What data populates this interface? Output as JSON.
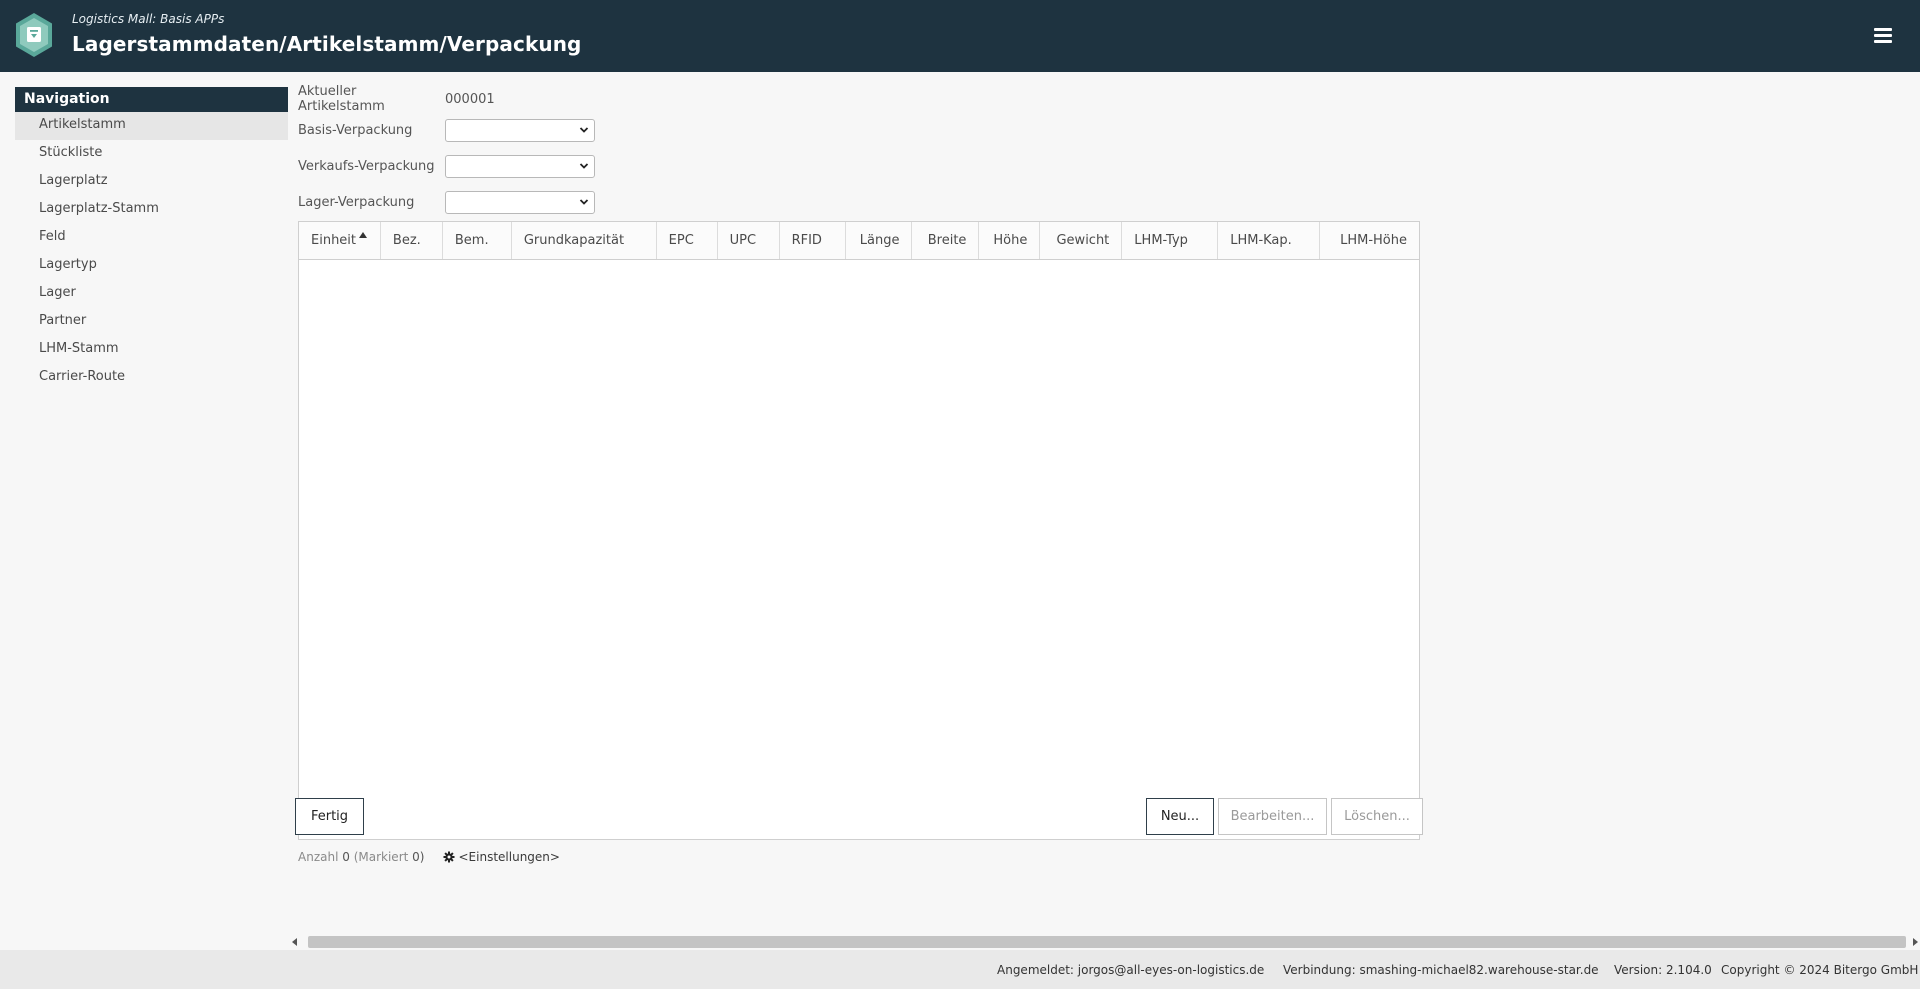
{
  "header": {
    "subtitle": "Logistics Mall: Basis APPs",
    "title": "Lagerstammdaten/Artikelstamm/Verpackung",
    "menu_icon": "hamburger-menu-icon",
    "logo_icon": "hexagon-logo-icon"
  },
  "colors": {
    "header_bg": "#1e3340",
    "accent": "#1e3340",
    "logo_teal": "#5aa89a"
  },
  "navigation": {
    "title": "Navigation",
    "items": [
      {
        "label": "Artikelstamm",
        "active": true
      },
      {
        "label": "Stückliste"
      },
      {
        "label": "Lagerplatz"
      },
      {
        "label": "Lagerplatz-Stamm"
      },
      {
        "label": "Feld"
      },
      {
        "label": "Lagertyp"
      },
      {
        "label": "Lager"
      },
      {
        "label": "Partner"
      },
      {
        "label": "LHM-Stamm"
      },
      {
        "label": "Carrier-Route"
      }
    ]
  },
  "form": {
    "current_label": "Aktueller Artikelstamm",
    "current_value": "000001",
    "basis_label": "Basis-Verpackung",
    "basis_value": "",
    "verkauf_label": "Verkaufs-Verpackung",
    "verkauf_value": "",
    "lager_label": "Lager-Verpackung",
    "lager_value": ""
  },
  "table": {
    "columns": [
      {
        "label": "Einheit",
        "sorted": "asc"
      },
      {
        "label": "Bez."
      },
      {
        "label": "Bem."
      },
      {
        "label": "Grundkapazität"
      },
      {
        "label": "EPC"
      },
      {
        "label": "UPC"
      },
      {
        "label": "RFID"
      },
      {
        "label": "Länge"
      },
      {
        "label": "Breite"
      },
      {
        "label": "Höhe"
      },
      {
        "label": "Gewicht"
      },
      {
        "label": "LHM-Typ"
      },
      {
        "label": "LHM-Kap."
      },
      {
        "label": "LHM-Höhe"
      }
    ],
    "rows": []
  },
  "summary": {
    "count_label": "Anzahl",
    "count": "0",
    "marked_label": "(Markiert",
    "marked": "0)",
    "settings_label": "<Einstellungen>",
    "settings_icon": "gear-icon"
  },
  "buttons": {
    "fertig": "Fertig",
    "neu": "Neu...",
    "bearbeiten": "Bearbeiten...",
    "loeschen": "Löschen..."
  },
  "status": {
    "user": "Angemeldet: jorgos@all-eyes-on-logistics.de",
    "connection": "Verbindung: smashing-michael82.warehouse-star.de",
    "version": "Version: 2.104.0",
    "copyright": "Copyright © 2024 Bitergo GmbH"
  }
}
